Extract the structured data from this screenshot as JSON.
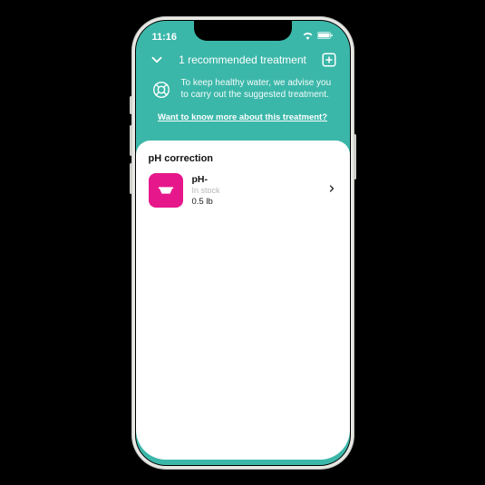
{
  "status": {
    "time": "11:16"
  },
  "header": {
    "title": "1 recommended treatment",
    "advisory": "To keep healthy water, we advise you to carry out the suggested treatment.",
    "know_more": "Want to know more about this treatment?"
  },
  "card": {
    "section_title": "pH correction",
    "treatment": {
      "name": "pH-",
      "stock": "In stock",
      "quantity": "0.5 lb"
    }
  },
  "colors": {
    "brand": "#3bb7a9",
    "accent": "#e6178b"
  }
}
